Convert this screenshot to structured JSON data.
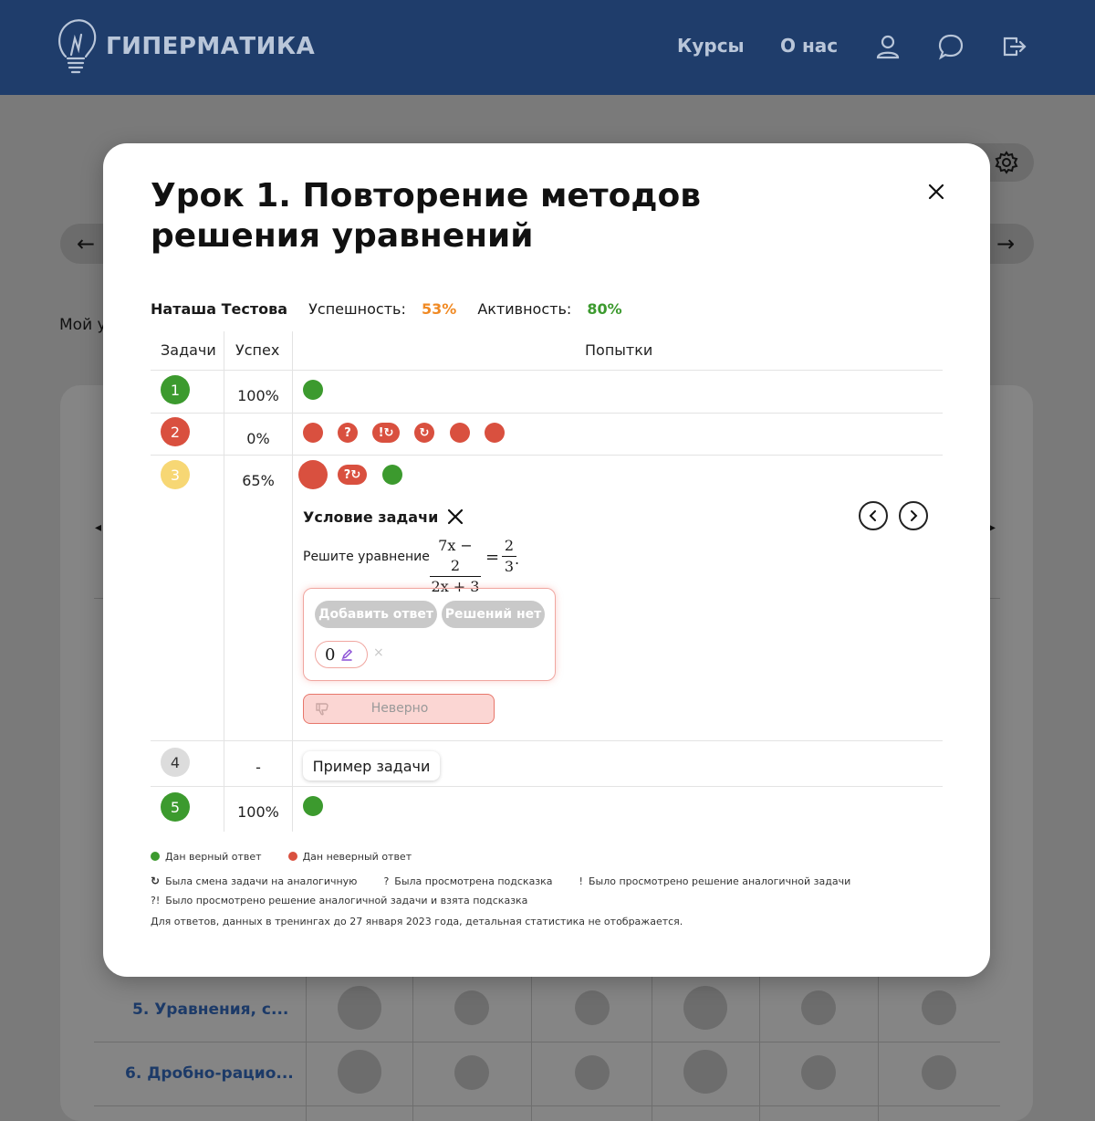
{
  "header": {
    "logo_text": "ГИПЕРМАТИКА",
    "nav_courses": "Курсы",
    "nav_about": "О нас",
    "bg_color": "#1f3d6b"
  },
  "background": {
    "my_text": "Мой у",
    "rows": [
      {
        "label": "5. Уравнения, с..."
      },
      {
        "label": "6. Дробно-рацио..."
      }
    ]
  },
  "modal": {
    "title": "Урок 1. Повторение методов решения уравнений",
    "student": "Наташа Тестова",
    "success_label": "Успешность:",
    "success_value": "53%",
    "activity_label": "Активность:",
    "activity_value": "80%",
    "columns": {
      "tasks": "Задачи",
      "success": "Успех",
      "attempts": "Попытки"
    },
    "tasks": [
      {
        "num": "1",
        "pct": "100%",
        "status": "green"
      },
      {
        "num": "2",
        "pct": "0%",
        "status": "red"
      },
      {
        "num": "3",
        "pct": "65%",
        "status": "yellow"
      },
      {
        "num": "4",
        "pct": "-",
        "status": "grey"
      },
      {
        "num": "5",
        "pct": "100%",
        "status": "green"
      }
    ],
    "attempt_marks": {
      "row2_q": "?",
      "row2_excl": "!",
      "row3_q": "?"
    },
    "condition": {
      "title": "Условие задачи",
      "text": "Решите уравнение",
      "num1": "7x − 2",
      "den1": "2x + 3",
      "eq": "=",
      "num2": "2",
      "den2": "3",
      "end": "."
    },
    "answer": {
      "add_button": "Добавить ответ",
      "no_solution_button": "Решений нет",
      "value": "0",
      "remove": "×",
      "verdict": "Неверно"
    },
    "example_button": "Пример задачи",
    "legend": {
      "correct": "Дан верный ответ",
      "wrong": "Дан неверный ответ",
      "swap": "Была смена задачи на аналогичную",
      "hint_sym": "?",
      "hint": "Была просмотрена подсказка",
      "solution_sym": "!",
      "solution": "Было просмотрено решение аналогичной задачи",
      "both_sym": "?!",
      "both": "Было просмотрено решение аналогичной задачи и взята подсказка",
      "note": "Для ответов, данных в тренингах до 27 января 2023 года, детальная статистика не отображается."
    }
  },
  "colors": {
    "green": "#3c9a2e",
    "red": "#d9503f",
    "yellow": "#f7d774",
    "orange": "#f08a24"
  }
}
